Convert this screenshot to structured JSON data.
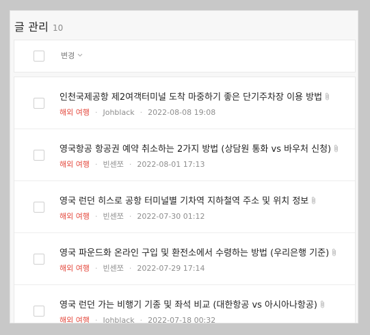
{
  "header": {
    "title": "글 관리",
    "count": "10"
  },
  "toolbar": {
    "sort_label": "변경"
  },
  "posts": [
    {
      "title": "인천국제공항 제2여객터미널 도착 마중하기 좋은 단기주차장 이용 방법",
      "category": "해외 여행",
      "author": "Johblack",
      "date": "2022-08-08 19:08"
    },
    {
      "title": "영국항공 항공권 예약 취소하는 2가지 방법 (상담원 통화 vs 바우처 신청)",
      "category": "해외 여행",
      "author": "빈센쪼",
      "date": "2022-08-01 17:13"
    },
    {
      "title": "영국 런던 히스로 공항 터미널별 기차역 지하철역 주소 및 위치 정보",
      "category": "해외 여행",
      "author": "빈센쪼",
      "date": "2022-07-30 01:12"
    },
    {
      "title": "영국 파운드화 온라인 구입 및 환전소에서 수령하는 방법 (우리은행 기준)",
      "category": "해외 여행",
      "author": "빈센쪼",
      "date": "2022-07-29 17:14"
    },
    {
      "title": "영국 런던 가는 비행기 기종 및 좌석 비교 (대한항공 vs 아시아나항공)",
      "category": "해외 여행",
      "author": "Johblack",
      "date": "2022-07-18 00:32"
    }
  ]
}
